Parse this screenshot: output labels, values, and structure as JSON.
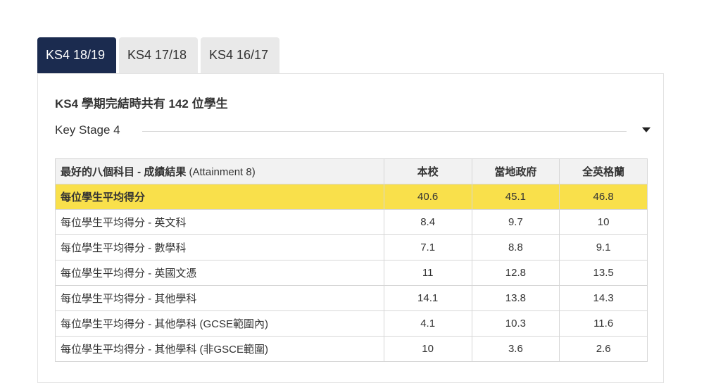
{
  "tabs": [
    {
      "label": "KS4 18/19",
      "active": true
    },
    {
      "label": "KS4 17/18",
      "active": false
    },
    {
      "label": "KS4 16/17",
      "active": false
    }
  ],
  "summary": "KS4 學期完結時共有 142 位學生",
  "stage": {
    "label": "Key Stage 4"
  },
  "table": {
    "header": {
      "label_bold": "最好的八個科目 - 成績結果",
      "label_rest": " (Attainment 8)",
      "cols": [
        "本校",
        "當地政府",
        "全英格蘭"
      ]
    },
    "rows": [
      {
        "label": "每位學生平均得分",
        "values": [
          "40.6",
          "45.1",
          "46.8"
        ],
        "highlight": true
      },
      {
        "label": "每位學生平均得分 - 英文科",
        "values": [
          "8.4",
          "9.7",
          "10"
        ]
      },
      {
        "label": "每位學生平均得分 - 數學科",
        "values": [
          "7.1",
          "8.8",
          "9.1"
        ]
      },
      {
        "label": "每位學生平均得分 - 英國文憑",
        "values": [
          "11",
          "12.8",
          "13.5"
        ]
      },
      {
        "label": "每位學生平均得分 - 其他學科",
        "values": [
          "14.1",
          "13.8",
          "14.3"
        ]
      },
      {
        "label": "每位學生平均得分 - 其他學科 (GCSE範圍內)",
        "values": [
          "4.1",
          "10.3",
          "11.6"
        ]
      },
      {
        "label": "每位學生平均得分 - 其他學科 (非GSCE範圍)",
        "values": [
          "10",
          "3.6",
          "2.6"
        ]
      }
    ]
  },
  "colors": {
    "tab_active": "#1b2b4f",
    "highlight": "#f9e04b"
  }
}
